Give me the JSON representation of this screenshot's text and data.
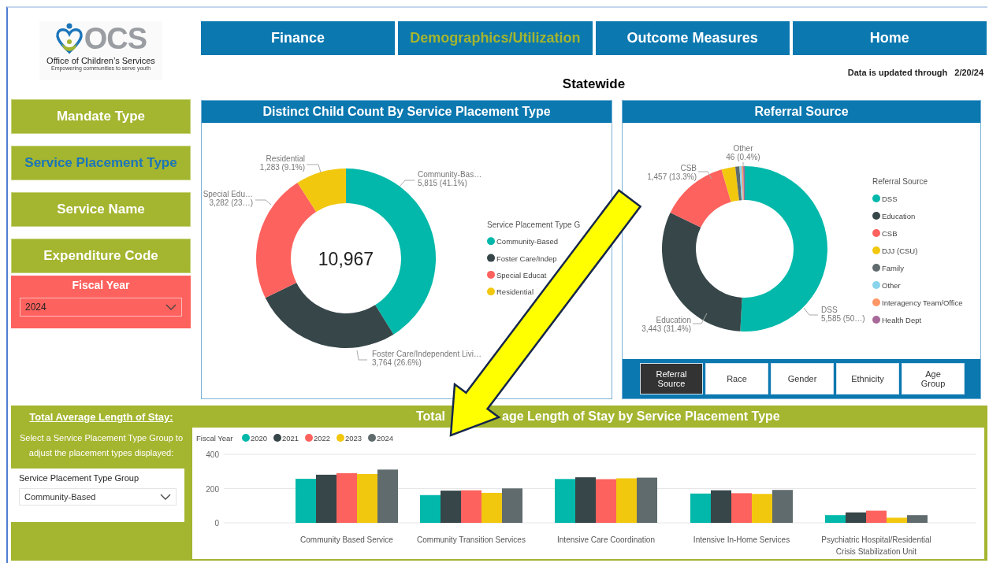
{
  "logo": {
    "acronym": "OCS",
    "name": "Office of Children’s Services",
    "tagline": "Empowering communities to serve youth"
  },
  "nav_tabs": [
    {
      "label": "Finance",
      "selected": false
    },
    {
      "label": "Demographics/Utilization",
      "selected": true
    },
    {
      "label": "Outcome Measures",
      "selected": false
    },
    {
      "label": "Home",
      "selected": false
    }
  ],
  "page_title": "Statewide",
  "update_note": {
    "label": "Data is updated through",
    "date": "2/20/24"
  },
  "filter_buttons": [
    {
      "label": "Mandate Type",
      "selected": false
    },
    {
      "label": "Service Placement Type",
      "selected": true
    },
    {
      "label": "Service Name",
      "selected": false
    },
    {
      "label": "Expenditure Code",
      "selected": false
    }
  ],
  "fiscal_year_filter": {
    "label": "Fiscal Year",
    "value": "2024"
  },
  "placement_chart": {
    "title": "Distinct Child Count By Service Placement Type",
    "center_label": "10,967",
    "chart_data": {
      "type": "donut",
      "categories": [
        "Community-Based",
        "Foster Care/Indep",
        "Special Educat",
        "Residential"
      ],
      "values": [
        5815,
        3764,
        3282,
        1283
      ],
      "colors": [
        "#01b8aa",
        "#374649",
        "#fd625e",
        "#f2c80f"
      ],
      "value_labels": [
        "Community-Bas…\n5,815 (41.1%)",
        "Foster Care/Independent Livi…\n3,764 (26.6%)",
        "Special Edu…\n3,282 (23…)",
        "Residential\n1,283 (9.1%)"
      ],
      "legend": {
        "title": "Service Placement Type G"
      }
    }
  },
  "referral_chart": {
    "title": "Referral Source",
    "chart_data": {
      "type": "donut",
      "categories": [
        "DSS",
        "Education",
        "CSB",
        "DJJ (CSU)",
        "Family",
        "Other",
        "Interagency Team/Office",
        "Health Dept"
      ],
      "values": [
        5585,
        3443,
        1457,
        296,
        88,
        46,
        30,
        22
      ],
      "colors": [
        "#01b8aa",
        "#374649",
        "#fd625e",
        "#f2c80f",
        "#5f6b6d",
        "#8ad4eb",
        "#fe9666",
        "#a66999"
      ],
      "value_labels": [
        "DSS\n5,585 (50…)",
        "Education\n3,443 (31.4%)",
        "CSB\n1,457 (13.3%)",
        null,
        null,
        "Other\n46 (0.4%)",
        null,
        null
      ],
      "legend": {
        "title": "Referral Source"
      }
    },
    "view_tabs": [
      {
        "label": "Referral Source",
        "selected": true
      },
      {
        "label": "Race",
        "selected": false
      },
      {
        "label": "Gender",
        "selected": false
      },
      {
        "label": "Ethnicity",
        "selected": false
      },
      {
        "label": "Age Group",
        "selected": false
      }
    ]
  },
  "stay_panel": {
    "heading": "Total Average Length of Stay:",
    "instructions": "Select a Service Placement Type Group to adjust the placement types displayed:",
    "group_filter": {
      "label": "Service Placement Type Group",
      "value": "Community-Based"
    }
  },
  "stay_chart": {
    "title_parts": [
      "Total",
      "age Length of Stay by Service Placement Type"
    ],
    "chart_data": {
      "type": "bar",
      "categories": [
        "Community Based Service",
        "Community Transition Services",
        "Intensive Care Coordination",
        "Intensive In-Home Services",
        "Psychiatric Hospital/Residential Crisis Stabilization Unit"
      ],
      "series": [
        {
          "name": "2020",
          "color": "#01b8aa",
          "values": [
            257,
            162,
            256,
            171,
            45
          ]
        },
        {
          "name": "2021",
          "color": "#374649",
          "values": [
            281,
            188,
            266,
            190,
            61
          ]
        },
        {
          "name": "2022",
          "color": "#fd625e",
          "values": [
            290,
            190,
            255,
            173,
            71
          ]
        },
        {
          "name": "2023",
          "color": "#f2c80f",
          "values": [
            285,
            175,
            260,
            169,
            30
          ]
        },
        {
          "name": "2024",
          "color": "#5f6b6d",
          "values": [
            311,
            201,
            264,
            192,
            45
          ]
        }
      ],
      "ylim": [
        0,
        400
      ],
      "yticks": [
        0,
        200,
        400
      ],
      "legend": {
        "title": "Fiscal Year"
      }
    }
  }
}
